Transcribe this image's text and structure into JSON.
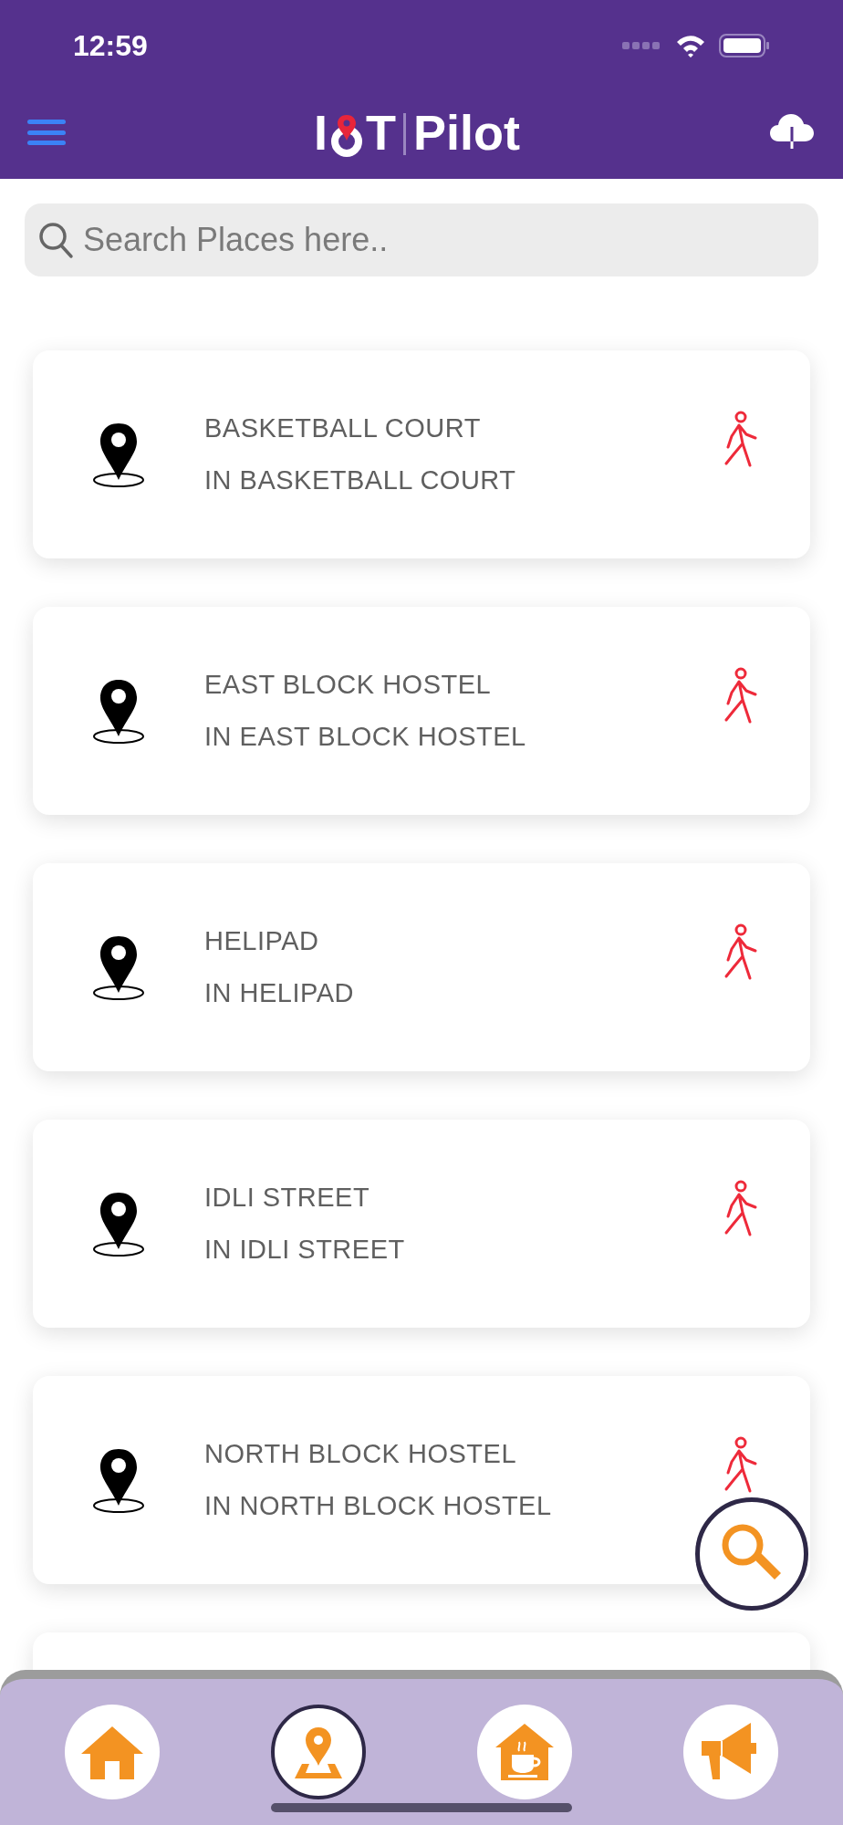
{
  "status_bar": {
    "time": "12:59"
  },
  "header": {
    "logo": {
      "first": "I",
      "second": "T",
      "third": "Pilot"
    }
  },
  "search": {
    "placeholder": "Search Places here.."
  },
  "places": [
    {
      "name": "BASKETBALL COURT",
      "location": "IN BASKETBALL COURT"
    },
    {
      "name": "EAST BLOCK HOSTEL",
      "location": "IN EAST BLOCK HOSTEL"
    },
    {
      "name": "HELIPAD",
      "location": "IN HELIPAD"
    },
    {
      "name": "IDLI STREET",
      "location": "IN IDLI STREET"
    },
    {
      "name": "NORTH BLOCK HOSTEL",
      "location": "IN NORTH BLOCK HOSTEL"
    }
  ],
  "bottom_nav": [
    {
      "kind": "home",
      "selected": false
    },
    {
      "kind": "map",
      "selected": true
    },
    {
      "kind": "cafe",
      "selected": false
    },
    {
      "kind": "announce",
      "selected": false
    }
  ]
}
